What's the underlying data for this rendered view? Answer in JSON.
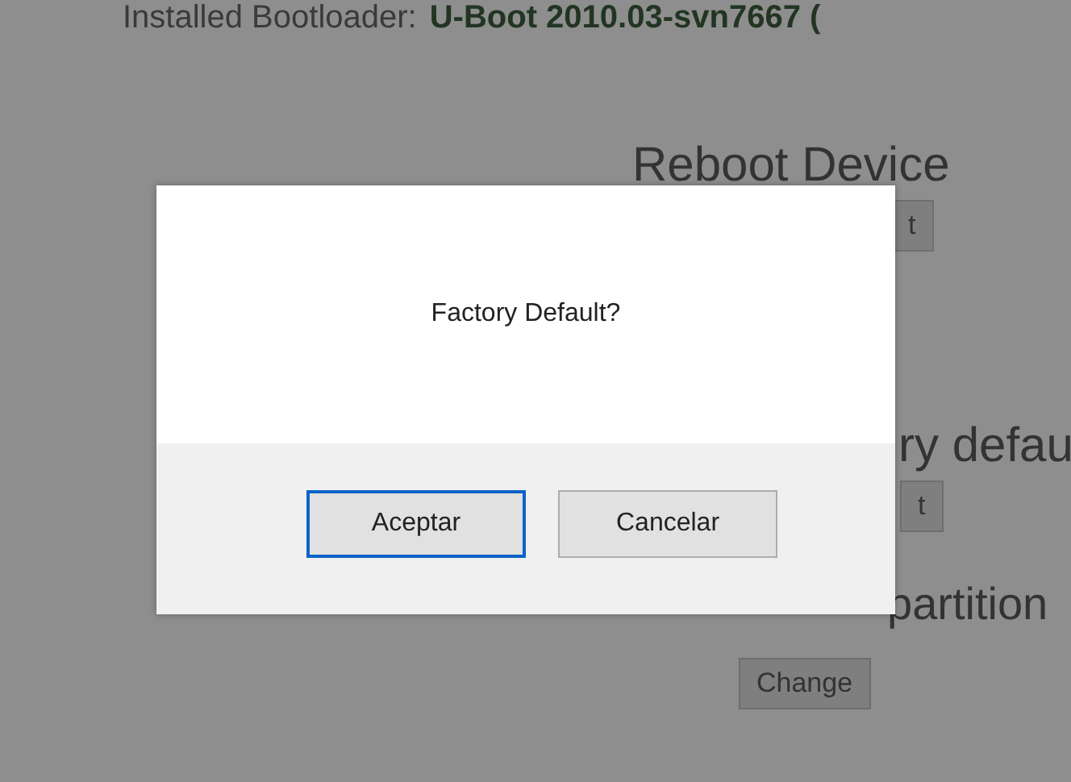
{
  "page": {
    "bootloader_label": "Installed Bootloader:",
    "bootloader_value": "U-Boot 2010.03-svn7667 (",
    "sections": [
      {
        "heading": "Reboot Device",
        "button": "t"
      },
      {
        "heading": "ry defau",
        "button": "t"
      },
      {
        "heading": "partition",
        "button": "Change"
      }
    ]
  },
  "dialog": {
    "message": "Factory Default?",
    "buttons": [
      {
        "label": "Aceptar",
        "focused": true
      },
      {
        "label": "Cancelar",
        "focused": false
      }
    ]
  }
}
